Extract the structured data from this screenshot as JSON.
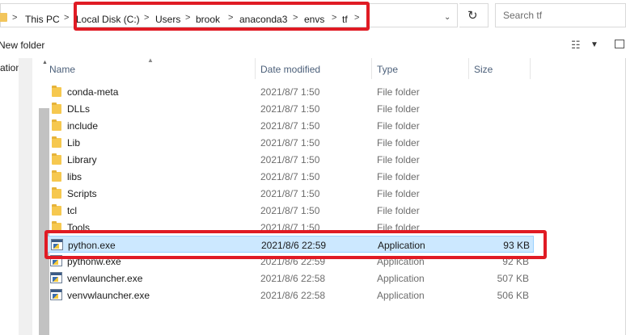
{
  "address_bar": {
    "crumbs": [
      "This PC",
      "Local Disk (C:)",
      "Users",
      "brook",
      "anaconda3",
      "envs",
      "tf"
    ],
    "separator": ">",
    "dropdown_glyph": "⌄",
    "refresh_glyph": "↻"
  },
  "search": {
    "placeholder": "Search tf",
    "value": ""
  },
  "commands": {
    "new_folder": "New folder",
    "view_glyph": "☷"
  },
  "nav_pane": {
    "label": "ation"
  },
  "columns": {
    "name": "Name",
    "date": "Date modified",
    "type": "Type",
    "size": "Size"
  },
  "files": [
    {
      "name": "conda-meta",
      "date": "2021/8/7 1:50",
      "type": "File folder",
      "size": "",
      "icon": "folder-icon"
    },
    {
      "name": "DLLs",
      "date": "2021/8/7 1:50",
      "type": "File folder",
      "size": "",
      "icon": "folder-icon"
    },
    {
      "name": "include",
      "date": "2021/8/7 1:50",
      "type": "File folder",
      "size": "",
      "icon": "folder-icon"
    },
    {
      "name": "Lib",
      "date": "2021/8/7 1:50",
      "type": "File folder",
      "size": "",
      "icon": "folder-icon"
    },
    {
      "name": "Library",
      "date": "2021/8/7 1:50",
      "type": "File folder",
      "size": "",
      "icon": "folder-icon"
    },
    {
      "name": "libs",
      "date": "2021/8/7 1:50",
      "type": "File folder",
      "size": "",
      "icon": "folder-icon"
    },
    {
      "name": "Scripts",
      "date": "2021/8/7 1:50",
      "type": "File folder",
      "size": "",
      "icon": "folder-icon"
    },
    {
      "name": "tcl",
      "date": "2021/8/7 1:50",
      "type": "File folder",
      "size": "",
      "icon": "folder-icon"
    },
    {
      "name": "Tools",
      "date": "2021/8/7 1:50",
      "type": "File folder",
      "size": "",
      "icon": "folder-icon"
    },
    {
      "name": "python.exe",
      "date": "2021/8/6 22:59",
      "type": "Application",
      "size": "93 KB",
      "icon": "python-exe-icon",
      "selected": true
    },
    {
      "name": "pythonw.exe",
      "date": "2021/8/6 22:59",
      "type": "Application",
      "size": "92 KB",
      "icon": "python-exe-icon"
    },
    {
      "name": "venvlauncher.exe",
      "date": "2021/8/6 22:58",
      "type": "Application",
      "size": "507 KB",
      "icon": "python-exe-icon"
    },
    {
      "name": "venvwlauncher.exe",
      "date": "2021/8/6 22:58",
      "type": "Application",
      "size": "506 KB",
      "icon": "python-exe-icon"
    }
  ],
  "colors": {
    "highlight_box": "#e01b24",
    "selection": "#cce8ff",
    "folder": "#f6c84f"
  }
}
